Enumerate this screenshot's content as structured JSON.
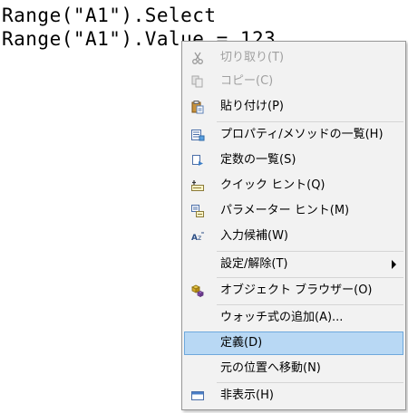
{
  "editor": {
    "line1": "Range(\"A1\").Select",
    "line2": "Range(\"A1\").Value = 123"
  },
  "context_menu": {
    "items": [
      {
        "label": "切り取り(T)",
        "icon": "scissors-icon",
        "enabled": false
      },
      {
        "label": "コピー(C)",
        "icon": "copy-icon",
        "enabled": false
      },
      {
        "label": "貼り付け(P)",
        "icon": "paste-icon",
        "enabled": true
      },
      {
        "label": "プロパティ/メソッドの一覧(H)",
        "icon": "list-properties-icon",
        "enabled": true
      },
      {
        "label": "定数の一覧(S)",
        "icon": "list-constants-icon",
        "enabled": true
      },
      {
        "label": "クイック ヒント(Q)",
        "icon": "quick-info-icon",
        "enabled": true
      },
      {
        "label": "パラメーター ヒント(M)",
        "icon": "parameter-info-icon",
        "enabled": true
      },
      {
        "label": "入力候補(W)",
        "icon": "complete-word-icon",
        "enabled": true
      },
      {
        "label": "設定/解除(T)",
        "icon": "",
        "enabled": true,
        "submenu": true
      },
      {
        "label": "オブジェクト ブラウザー(O)",
        "icon": "object-browser-icon",
        "enabled": true
      },
      {
        "label": "ウォッチ式の追加(A)...",
        "icon": "",
        "enabled": true
      },
      {
        "label": "定義(D)",
        "icon": "",
        "enabled": true,
        "selected": true
      },
      {
        "label": "元の位置へ移動(N)",
        "icon": "",
        "enabled": true
      },
      {
        "label": "非表示(H)",
        "icon": "hide-window-icon",
        "enabled": true
      }
    ]
  }
}
